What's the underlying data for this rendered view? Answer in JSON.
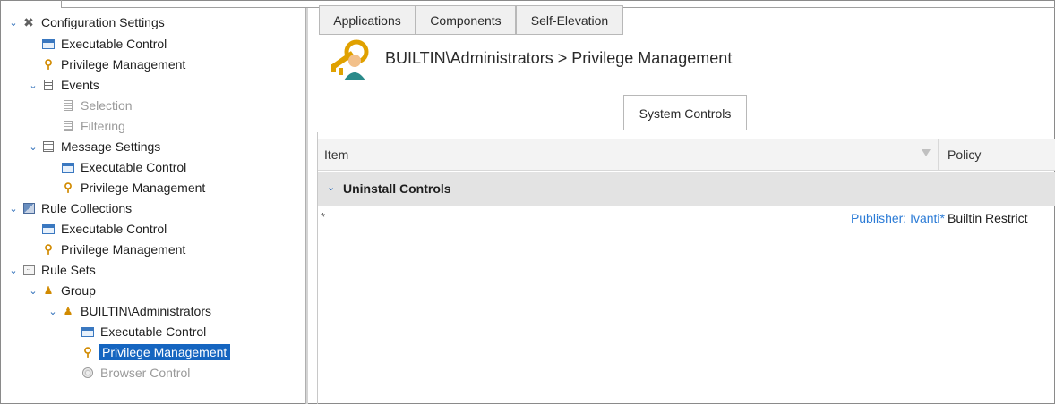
{
  "tree": [
    {
      "label": "Configuration Settings",
      "icon": "tools-icon",
      "chevron": true
    },
    {
      "label": "Executable Control",
      "icon": "executable-control-icon",
      "chevron": false
    },
    {
      "label": "Privilege Management",
      "icon": "privilege-management-icon",
      "chevron": false
    },
    {
      "label": "Events",
      "icon": "document-icon",
      "chevron": true
    },
    {
      "label": "Selection",
      "icon": "document-icon",
      "chevron": false,
      "disabled": true
    },
    {
      "label": "Filtering",
      "icon": "document-icon",
      "chevron": false,
      "disabled": true
    },
    {
      "label": "Message Settings",
      "icon": "message-settings-icon",
      "chevron": true
    },
    {
      "label": "Executable Control",
      "icon": "executable-control-icon",
      "chevron": false
    },
    {
      "label": "Privilege Management",
      "icon": "privilege-management-icon",
      "chevron": false
    },
    {
      "label": "Rule Collections",
      "icon": "rule-collections-icon",
      "chevron": true
    },
    {
      "label": "Executable Control",
      "icon": "executable-control-icon",
      "chevron": false
    },
    {
      "label": "Privilege Management",
      "icon": "privilege-management-icon",
      "chevron": false
    },
    {
      "label": "Rule Sets",
      "icon": "rule-sets-icon",
      "chevron": true
    },
    {
      "label": "Group",
      "icon": "group-icon",
      "chevron": true
    },
    {
      "label": "BUILTIN\\Administrators",
      "icon": "group-icon",
      "chevron": true
    },
    {
      "label": "Executable Control",
      "icon": "executable-control-icon",
      "chevron": false
    },
    {
      "label": "Privilege Management",
      "icon": "privilege-management-icon",
      "chevron": false,
      "selected": true
    },
    {
      "label": "Browser Control",
      "icon": "browser-control-icon",
      "chevron": false,
      "disabled": true
    }
  ],
  "header": {
    "title": "BUILTIN\\Administrators > Privilege Management",
    "icon": "privilege-management-icon"
  },
  "tabs": [
    {
      "label": "Applications"
    },
    {
      "label": "Components"
    },
    {
      "label": "Self-Elevation"
    },
    {
      "label": "System Controls",
      "active": true
    }
  ],
  "grid": {
    "columns": {
      "item": "Item",
      "policy": "Policy"
    },
    "group": {
      "label": "Uninstall Controls"
    },
    "rows": [
      {
        "item": "*",
        "publisher": "Publisher: Ivanti*",
        "policy": "Builtin Restrict"
      }
    ]
  },
  "colors": {
    "selection": "#1565c0",
    "link": "#2b7bd6",
    "accent": "#2b6cb8",
    "group_row": "#e3e3e3"
  }
}
